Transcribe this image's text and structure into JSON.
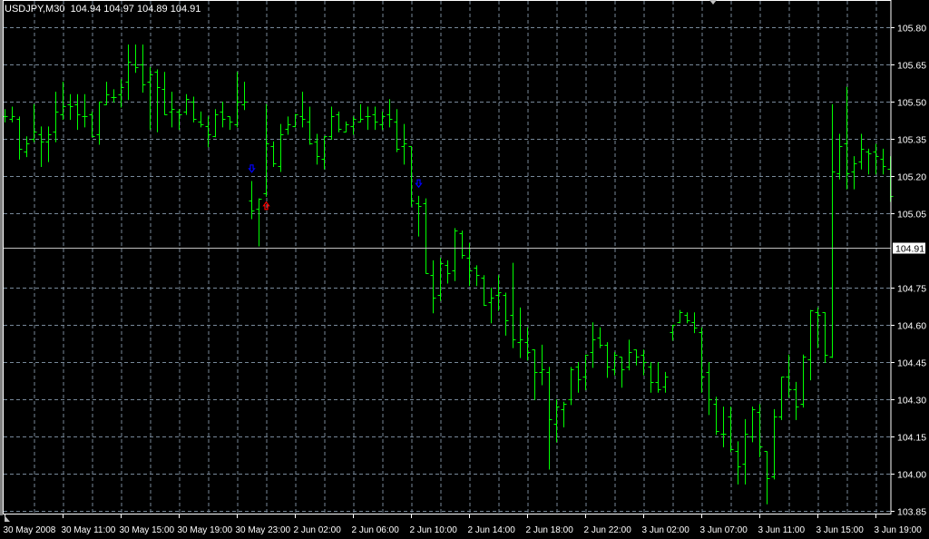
{
  "header": {
    "symbol": "USDJPY,M30",
    "open": "104.94",
    "high": "104.97",
    "low": "104.89",
    "close": "104.91"
  },
  "colors": {
    "background": "#000000",
    "bar": "#00ff00",
    "grid": "#778899",
    "axis": "#ffffff",
    "sell_arrow": "#0000ff",
    "buy_arrow": "#ff0000"
  },
  "chart_data": {
    "type": "ohlc",
    "title": "USDJPY,M30",
    "ylim": [
      103.85,
      105.8
    ],
    "y_ticks": [
      "105.80",
      "105.65",
      "105.50",
      "105.35",
      "105.20",
      "105.05",
      "104.75",
      "104.60",
      "104.45",
      "104.30",
      "104.15",
      "104.00",
      "103.85"
    ],
    "current_price": "104.91",
    "x_ticks": [
      {
        "bar": 0,
        "label": "30 May 2008"
      },
      {
        "bar": 8,
        "label": "30 May 11:00"
      },
      {
        "bar": 16,
        "label": "30 May 15:00"
      },
      {
        "bar": 24,
        "label": "30 May 19:00"
      },
      {
        "bar": 32,
        "label": "30 May 23:00"
      },
      {
        "bar": 40,
        "label": "2 Jun 02:00"
      },
      {
        "bar": 48,
        "label": "2 Jun 06:00"
      },
      {
        "bar": 56,
        "label": "2 Jun 10:00"
      },
      {
        "bar": 64,
        "label": "2 Jun 14:00"
      },
      {
        "bar": 72,
        "label": "2 Jun 18:00"
      },
      {
        "bar": 80,
        "label": "2 Jun 22:00"
      },
      {
        "bar": 88,
        "label": "3 Jun 02:00"
      },
      {
        "bar": 96,
        "label": "3 Jun 07:00"
      },
      {
        "bar": 104,
        "label": "3 Jun 11:00"
      },
      {
        "bar": 112,
        "label": "3 Jun 15:00"
      },
      {
        "bar": 120,
        "label": "3 Jun 19:00"
      }
    ],
    "arrows": [
      {
        "bar": 34,
        "price": 105.23,
        "direction": "down",
        "color": "#0000ff"
      },
      {
        "bar": 36,
        "price": 105.08,
        "direction": "up",
        "color": "#ff0000"
      },
      {
        "bar": 57,
        "price": 105.17,
        "direction": "down",
        "color": "#0000ff"
      }
    ],
    "ohlc": [
      [
        105.44,
        105.47,
        105.42,
        105.44
      ],
      [
        105.43,
        105.48,
        105.42,
        105.44
      ],
      [
        105.43,
        105.44,
        105.27,
        105.31
      ],
      [
        105.3,
        105.36,
        105.28,
        105.33
      ],
      [
        105.35,
        105.49,
        105.34,
        105.38
      ],
      [
        105.37,
        105.4,
        105.24,
        105.34
      ],
      [
        105.34,
        105.4,
        105.26,
        105.37
      ],
      [
        105.38,
        105.54,
        105.34,
        105.46
      ],
      [
        105.45,
        105.58,
        105.43,
        105.48
      ],
      [
        105.49,
        105.53,
        105.43,
        105.48
      ],
      [
        105.49,
        105.53,
        105.39,
        105.45
      ],
      [
        105.44,
        105.53,
        105.4,
        105.44
      ],
      [
        105.45,
        105.46,
        105.36,
        105.36
      ],
      [
        105.37,
        105.5,
        105.33,
        105.5
      ],
      [
        105.49,
        105.58,
        105.49,
        105.53
      ],
      [
        105.52,
        105.55,
        105.5,
        105.52
      ],
      [
        105.53,
        105.59,
        105.48,
        105.56
      ],
      [
        105.58,
        105.73,
        105.51,
        105.66
      ],
      [
        105.65,
        105.73,
        105.62,
        105.64
      ],
      [
        105.65,
        105.73,
        105.54,
        105.57
      ],
      [
        105.58,
        105.64,
        105.39,
        105.61
      ],
      [
        105.62,
        105.63,
        105.38,
        105.56
      ],
      [
        105.55,
        105.62,
        105.45,
        105.45
      ],
      [
        105.46,
        105.54,
        105.4,
        105.47
      ],
      [
        105.46,
        105.47,
        105.39,
        105.45
      ],
      [
        105.46,
        105.53,
        105.45,
        105.51
      ],
      [
        105.5,
        105.52,
        105.42,
        105.43
      ],
      [
        105.42,
        105.46,
        105.4,
        105.41
      ],
      [
        105.4,
        105.44,
        105.32,
        105.37
      ],
      [
        105.36,
        105.47,
        105.36,
        105.45
      ],
      [
        105.46,
        105.5,
        105.4,
        105.43
      ],
      [
        105.44,
        105.44,
        105.39,
        105.42
      ],
      [
        105.41,
        105.62,
        105.4,
        105.5
      ],
      [
        105.49,
        105.58,
        105.47,
        105.5
      ],
      [
        105.1,
        105.18,
        105.03,
        105.06
      ],
      [
        105.07,
        105.11,
        104.92,
        105.11
      ],
      [
        105.13,
        105.49,
        105.12,
        105.33
      ],
      [
        105.32,
        105.34,
        105.24,
        105.25
      ],
      [
        105.24,
        105.41,
        105.22,
        105.37
      ],
      [
        105.39,
        105.44,
        105.37,
        105.41
      ],
      [
        105.4,
        105.45,
        105.4,
        105.45
      ],
      [
        105.44,
        105.54,
        105.4,
        105.43
      ],
      [
        105.42,
        105.48,
        105.33,
        105.33
      ],
      [
        105.34,
        105.37,
        105.25,
        105.28
      ],
      [
        105.27,
        105.36,
        105.23,
        105.36
      ],
      [
        105.36,
        105.48,
        105.35,
        105.44
      ],
      [
        105.45,
        105.46,
        105.38,
        105.39
      ],
      [
        105.38,
        105.42,
        105.38,
        105.41
      ],
      [
        105.4,
        105.44,
        105.37,
        105.43
      ],
      [
        105.42,
        105.49,
        105.42,
        105.43
      ],
      [
        105.44,
        105.48,
        105.39,
        105.44
      ],
      [
        105.45,
        105.48,
        105.39,
        105.42
      ],
      [
        105.41,
        105.46,
        105.39,
        105.44
      ],
      [
        105.45,
        105.51,
        105.4,
        105.43
      ],
      [
        105.42,
        105.47,
        105.3,
        105.31
      ],
      [
        105.32,
        105.41,
        105.25,
        105.33
      ],
      [
        105.32,
        105.32,
        105.08,
        105.1
      ],
      [
        105.09,
        105.12,
        104.96,
        105.08
      ],
      [
        105.09,
        105.11,
        104.81,
        104.81
      ],
      [
        104.8,
        104.86,
        104.65,
        104.71
      ],
      [
        104.72,
        104.87,
        104.7,
        104.85
      ],
      [
        104.84,
        104.86,
        104.77,
        104.81
      ],
      [
        104.82,
        104.99,
        104.78,
        104.98
      ],
      [
        104.97,
        104.98,
        104.87,
        104.88
      ],
      [
        104.87,
        104.93,
        104.76,
        104.82
      ],
      [
        104.83,
        104.84,
        104.76,
        104.8
      ],
      [
        104.79,
        104.8,
        104.68,
        104.68
      ],
      [
        104.69,
        104.75,
        104.61,
        104.71
      ],
      [
        104.72,
        104.8,
        104.66,
        104.73
      ],
      [
        104.72,
        104.73,
        104.56,
        104.62
      ],
      [
        104.64,
        104.85,
        104.51,
        104.54
      ],
      [
        104.53,
        104.67,
        104.47,
        104.54
      ],
      [
        104.53,
        104.59,
        104.46,
        104.49
      ],
      [
        104.5,
        104.5,
        104.3,
        104.41
      ],
      [
        104.41,
        104.52,
        104.36,
        104.42
      ],
      [
        104.41,
        104.43,
        104.02,
        104.22
      ],
      [
        104.2,
        104.3,
        104.13,
        104.27
      ],
      [
        104.26,
        104.29,
        104.19,
        104.28
      ],
      [
        104.3,
        104.43,
        104.28,
        104.42
      ],
      [
        104.43,
        104.45,
        104.33,
        104.38
      ],
      [
        104.39,
        104.48,
        104.34,
        104.48
      ],
      [
        104.49,
        104.61,
        104.43,
        104.54
      ],
      [
        104.55,
        104.59,
        104.51,
        104.52
      ],
      [
        104.52,
        104.53,
        104.39,
        104.43
      ],
      [
        104.42,
        104.49,
        104.4,
        104.48
      ],
      [
        104.47,
        104.47,
        104.35,
        104.42
      ],
      [
        104.43,
        104.54,
        104.42,
        104.49
      ],
      [
        104.5,
        104.5,
        104.44,
        104.47
      ],
      [
        104.48,
        104.5,
        104.4,
        104.45
      ],
      [
        104.43,
        104.45,
        104.33,
        104.37
      ],
      [
        104.37,
        104.45,
        104.33,
        104.34
      ],
      [
        104.35,
        104.41,
        104.33,
        104.39
      ],
      [
        104.57,
        104.6,
        104.54,
        104.6
      ],
      [
        104.61,
        104.66,
        104.61,
        104.65
      ],
      [
        104.64,
        104.65,
        104.61,
        104.62
      ],
      [
        104.61,
        104.65,
        104.57,
        104.59
      ],
      [
        104.57,
        104.59,
        104.33,
        104.39
      ],
      [
        104.41,
        104.45,
        104.24,
        104.3
      ],
      [
        104.28,
        104.31,
        104.16,
        104.17
      ],
      [
        104.16,
        104.27,
        104.11,
        104.16
      ],
      [
        104.23,
        104.27,
        104.09,
        104.1
      ],
      [
        104.09,
        104.13,
        103.96,
        104.03
      ],
      [
        104.04,
        104.22,
        103.96,
        104.16
      ],
      [
        104.15,
        104.27,
        104.13,
        104.26
      ],
      [
        104.25,
        104.28,
        104.07,
        104.11
      ],
      [
        104.09,
        104.09,
        103.88,
        103.98
      ],
      [
        103.99,
        104.26,
        103.98,
        104.23
      ],
      [
        104.23,
        104.39,
        104.22,
        104.39
      ],
      [
        104.39,
        104.48,
        104.31,
        104.34
      ],
      [
        104.34,
        104.37,
        104.22,
        104.27
      ],
      [
        104.28,
        104.48,
        104.27,
        104.47
      ],
      [
        104.46,
        104.66,
        104.38,
        104.66
      ],
      [
        104.65,
        104.67,
        104.51,
        104.64
      ],
      [
        104.65,
        104.65,
        104.45,
        104.48
      ],
      [
        104.47,
        105.49,
        104.47,
        105.22
      ],
      [
        105.21,
        105.37,
        105.19,
        105.32
      ],
      [
        105.33,
        105.56,
        105.15,
        105.21
      ],
      [
        105.22,
        105.28,
        105.15,
        105.25
      ],
      [
        105.26,
        105.37,
        105.23,
        105.31
      ],
      [
        105.3,
        105.31,
        105.21,
        105.29
      ],
      [
        105.3,
        105.33,
        105.21,
        105.28
      ],
      [
        105.27,
        105.31,
        105.21,
        105.24
      ],
      [
        105.23,
        105.28,
        105.1,
        105.12
      ]
    ]
  }
}
